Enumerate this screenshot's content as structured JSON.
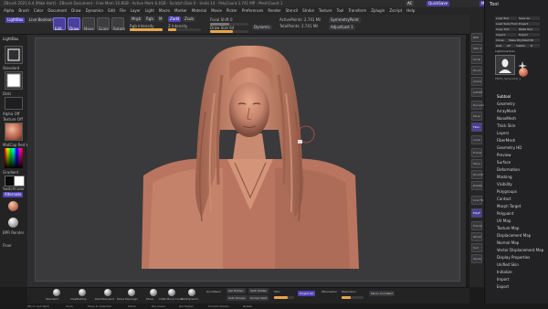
{
  "window": {
    "title": "ZBrush 2021.6.4 [Mike Hart] - ZBrush Document - Free Mem 10.8GB - Active Mem 6.4GB - Scratch Disk 0 - Undo 14 - PolyCount 2.741 MP - MeshCount 1",
    "right_chips": [
      "AC",
      "QuickSave",
      "Menus",
      "DefaultZScript"
    ]
  },
  "menubar": [
    "Alpha",
    "Brush",
    "Color",
    "Document",
    "Draw",
    "Dynamics",
    "Edit",
    "File",
    "Layer",
    "Light",
    "Macro",
    "Marker",
    "Material",
    "Movie",
    "Picker",
    "Preferences",
    "Render",
    "Stencil",
    "Stroke",
    "Texture",
    "Tool",
    "Transform",
    "Zplugin",
    "Zscript",
    "Help"
  ],
  "toolbar": {
    "lightbox_label": "LightBox",
    "live_boolean_label": "Live Boolean",
    "edit_label": "Edit",
    "draw_label": "Draw",
    "move_label": "Move",
    "scale_label": "Scale",
    "rotate_label": "Rotate",
    "mrgb_label": "Mrgb",
    "rgb_label": "Rgb",
    "m_label": "M",
    "zadd_label": "Zadd",
    "zsub_label": "Zsub",
    "rgb_intensity_label": "Rgb Intensity",
    "z_intensity_label": "Z Intensity",
    "z_intensity_value": "25",
    "focal_shift_label": "Focal Shift 0",
    "draw_size_label": "Draw Size 64",
    "dynamic_label": "Dynamic",
    "active_points_label": "ActivePoints: 2.741 Mil",
    "total_points_label": "TotalPoints: 2.741 Mil",
    "symmetry_label": "SymmetryPoint",
    "adjust_label": "AdjustLast 1"
  },
  "leftshelf": {
    "top_label": "LightBox",
    "brush_label": "Standard",
    "stroke_label": "Dots",
    "alpha_label": "Alpha Off",
    "texture_label": "Texture Off",
    "material_label": "MatCap Red Wax",
    "gradient_label": "Gradient",
    "switch_label": "SwitchColor",
    "alternate_label": "Alternate",
    "bpr_label": "BPR Render",
    "floor_label": "Floor"
  },
  "viewport": {
    "subject": "clay bust sculpt"
  },
  "rightcol": [
    "BPR",
    "SPix 3",
    "Scroll",
    "Zoom",
    "Actual",
    "AAHalf",
    "Dynamic",
    "Persp",
    "Floor",
    "Local",
    "Frame",
    "Move",
    "ZoomD",
    "Rotate",
    "Line Fill",
    "PolyF",
    "Transp",
    "Ghost",
    "Solo",
    "Xpose"
  ],
  "tool": {
    "title": "Tool",
    "buttons": [
      "Load Tool",
      "Save As",
      "Load Tools From Project",
      "Copy Tool",
      "Paste Tool",
      "Import",
      "Export",
      "Clone",
      "Make PolyMesh3D",
      "GoZ",
      "All",
      "Visible",
      "R"
    ],
    "lightbox_tools": "Lightbox▸Tools",
    "current_tool": "PM3D_Sphere3D_1",
    "subpalettes": [
      "Subtool",
      "Geometry",
      "ArrayMesh",
      "NanoMesh",
      "Thick Skin",
      "Layers",
      "FiberMesh",
      "Geometry HD",
      "Preview",
      "Surface",
      "Deformation",
      "Masking",
      "Visibility",
      "Polygroups",
      "Contact",
      "Morph Target",
      "Polypaint",
      "UV Map",
      "Texture Map",
      "Displacement Map",
      "Normal Map",
      "Vector Displacement Map",
      "Display Properties",
      "Unified Skin",
      "Initialize",
      "Import",
      "Export"
    ]
  },
  "bottombar": {
    "brushes": [
      "Standard",
      "ClayBuildup",
      "DamStandard",
      "Move Topologic",
      "Move",
      "Inflat Move Curve",
      "TrimDynamic"
    ],
    "dynamesh_label": "DynaMesh",
    "zremesher_label": "ZRemesher",
    "del_hidden_label": "Del Hidden",
    "split_label": "Split Hidden",
    "auto_groups_label": "Auto Groups",
    "group_split_label": "Groups Split",
    "sdiv_label": "SDiv",
    "project_label": "Project All",
    "zremesh_label": "ZRemesher",
    "resolution_label": "Resolution",
    "mirror_label": "Mirror And Weld"
  },
  "statusbar": [
    "Mirror and Weld",
    "Undo",
    "Move to Selected",
    "Polish",
    "Del Lower",
    "Del Higher",
    "Smooth Subdiv",
    "Rotate"
  ]
}
